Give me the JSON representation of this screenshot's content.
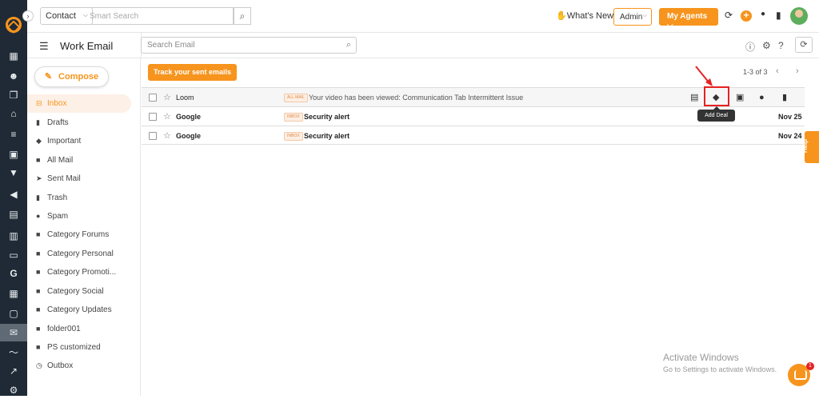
{
  "topbar": {
    "contact_select": "Contact",
    "search_placeholder": "Smart Search",
    "whats_new": "What's New",
    "admin": "Admin",
    "my_agents": "My Agents"
  },
  "subbar": {
    "title": "Work Email",
    "search_placeholder": "Search Email"
  },
  "sidebar": {
    "compose": "Compose",
    "folders": [
      {
        "label": "Inbox",
        "icon": "inbox-icon"
      },
      {
        "label": "Drafts",
        "icon": "file-icon"
      },
      {
        "label": "Important",
        "icon": "tag-icon"
      },
      {
        "label": "All Mail",
        "icon": "folder-icon"
      },
      {
        "label": "Sent Mail",
        "icon": "send-icon"
      },
      {
        "label": "Trash",
        "icon": "trash-icon"
      },
      {
        "label": "Spam",
        "icon": "alert-icon"
      },
      {
        "label": "Category Forums",
        "icon": "folder-icon"
      },
      {
        "label": "Category Personal",
        "icon": "folder-icon"
      },
      {
        "label": "Category Promoti...",
        "icon": "folder-icon"
      },
      {
        "label": "Category Social",
        "icon": "folder-icon"
      },
      {
        "label": "Category Updates",
        "icon": "folder-icon"
      },
      {
        "label": "folder001",
        "icon": "folder-icon"
      },
      {
        "label": "PS customized",
        "icon": "folder-icon"
      },
      {
        "label": "Outbox",
        "icon": "clock-icon"
      }
    ]
  },
  "main": {
    "track_button": "Track your sent emails",
    "pagination": "1-3 of 3",
    "emails": [
      {
        "sender": "Loom",
        "tag": "ALL MAIL",
        "subject": "Your video has been viewed: Communication Tab Intermittent Issue",
        "date": ""
      },
      {
        "sender": "Google",
        "tag": "INBOX",
        "subject": "Security alert",
        "date": "Nov 25"
      },
      {
        "sender": "Google",
        "tag": "INBOX",
        "subject": "Security alert",
        "date": "Nov 24"
      }
    ],
    "tooltip": "Add Deal"
  },
  "help": "Help",
  "watermark": {
    "line1": "Activate Windows",
    "line2": "Go to Settings to activate Windows."
  },
  "chat_badge": "1"
}
